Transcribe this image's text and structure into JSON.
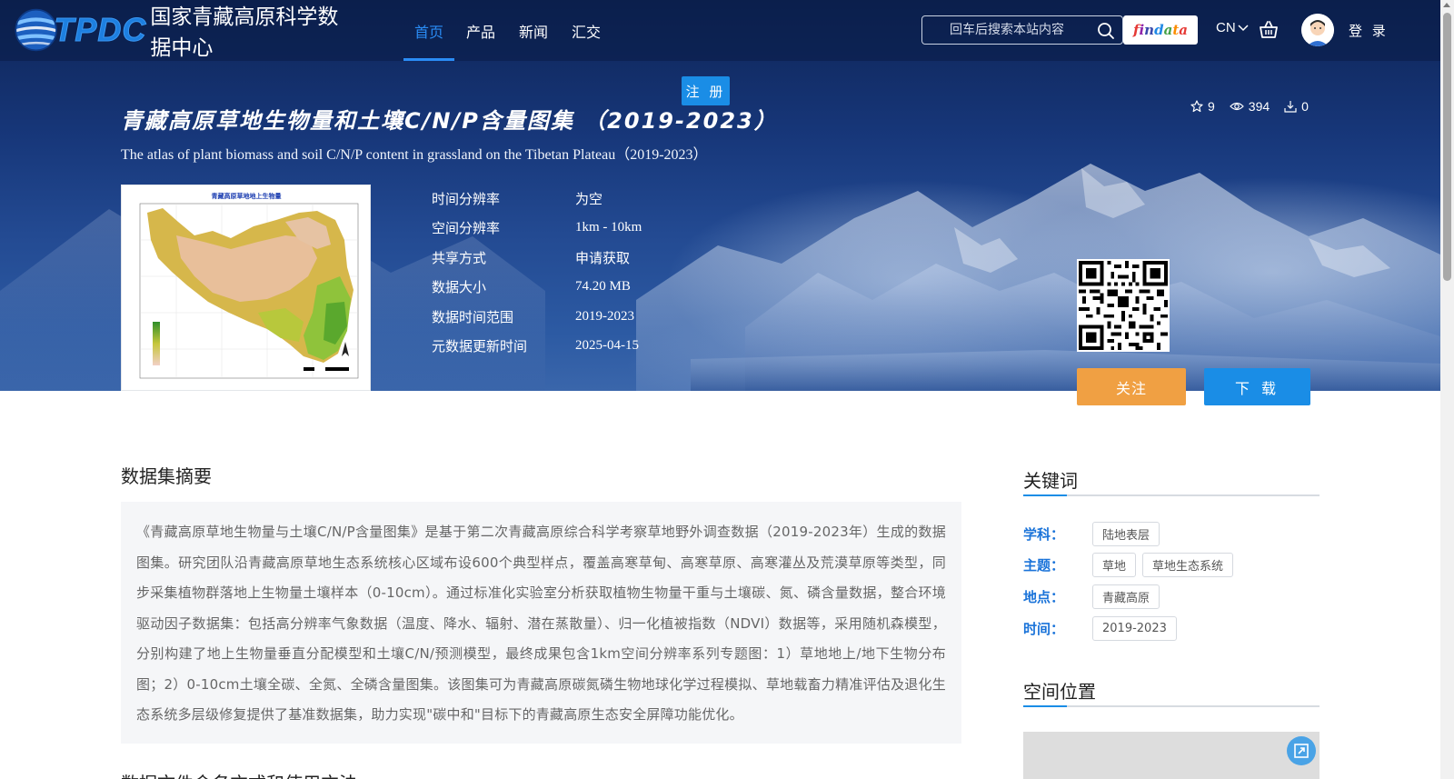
{
  "header": {
    "logo_text": "TPDC",
    "site_name": "国家青藏高原科学数据中心",
    "nav": [
      {
        "label": "首页",
        "active": true
      },
      {
        "label": "产品",
        "active": false
      },
      {
        "label": "新闻",
        "active": false
      },
      {
        "label": "汇交",
        "active": false
      }
    ],
    "search_placeholder": "回车后搜索本站内容",
    "search_icon": "search-icon",
    "findata_label": "findata",
    "language": "CN",
    "cart_icon": "basket-icon",
    "avatar_icon": "user-avatar",
    "login_label": "登 录"
  },
  "register_label": "注 册",
  "dataset": {
    "title_cn": "青藏高原草地生物量和土壤C/N/P含量图集 （2019-2023）",
    "title_en": "The atlas of plant biomass and soil C/N/P content in grassland on the Tibetan Plateau（2019-2023）",
    "stats": {
      "favorites": "9",
      "views": "394",
      "downloads": "0"
    },
    "thumbnail_title": "青藏高原草地地上生物量",
    "metadata": [
      {
        "key": "时间分辨率",
        "value": "为空"
      },
      {
        "key": "空间分辨率",
        "value": "1km - 10km"
      },
      {
        "key": "共享方式",
        "value": "申请获取"
      },
      {
        "key": "数据大小",
        "value": "74.20 MB"
      },
      {
        "key": "数据时间范围",
        "value": "2019-2023"
      },
      {
        "key": "元数据更新时间",
        "value": "2025-04-15"
      }
    ],
    "follow_label": "关注",
    "download_label": "下 载"
  },
  "abstract": {
    "title": "数据集摘要",
    "text": "《青藏高原草地生物量与土壤C/N/P含量图集》是基于第二次青藏高原综合科学考察草地野外调查数据（2019-2023年）生成的数据图集。研究团队沿青藏高原草地生态系统核心区域布设600个典型样点，覆盖高寒草甸、高寒草原、高寒灌丛及荒漠草原等类型，同步采集植物群落地上生物量土壤样本（0-10cm）。通过标准化实验室分析获取植物生物量干重与土壤碳、氮、磷含量数据，整合环境驱动因子数据集：包括高分辨率气象数据（温度、降水、辐射、潜在蒸散量）、归一化植被指数（NDVI）数据等，采用随机森模型，分别构建了地上生物量垂直分配模型和土壤C/N/预测模型，最终成果包含1km空间分辨率系列专题图：1）草地地上/地下生物分布图；2）0-10cm土壤全碳、全氮、全磷含量图集。该图集可为青藏高原碳氮磷生物地球化学过程模拟、草地载畜力精准评估及退化生态系统多层级修复提供了基准数据集，助力实现\"碳中和\"目标下的青藏高原生态安全屏障功能优化。"
  },
  "next_section_title": "数据文件命名方式和使用方法",
  "keywords": {
    "title": "关键词",
    "rows": [
      {
        "label": "学科：",
        "tags": [
          "陆地表层"
        ]
      },
      {
        "label": "主题：",
        "tags": [
          "草地",
          "草地生态系统"
        ]
      },
      {
        "label": "地点：",
        "tags": [
          "青藏高原"
        ]
      },
      {
        "label": "时间：",
        "tags": [
          "2019-2023"
        ]
      }
    ]
  },
  "spatial": {
    "title": "空间位置"
  },
  "colors": {
    "accent": "#1a8de6",
    "follow": "#f0a043",
    "nav_active": "#2a8cf5"
  }
}
